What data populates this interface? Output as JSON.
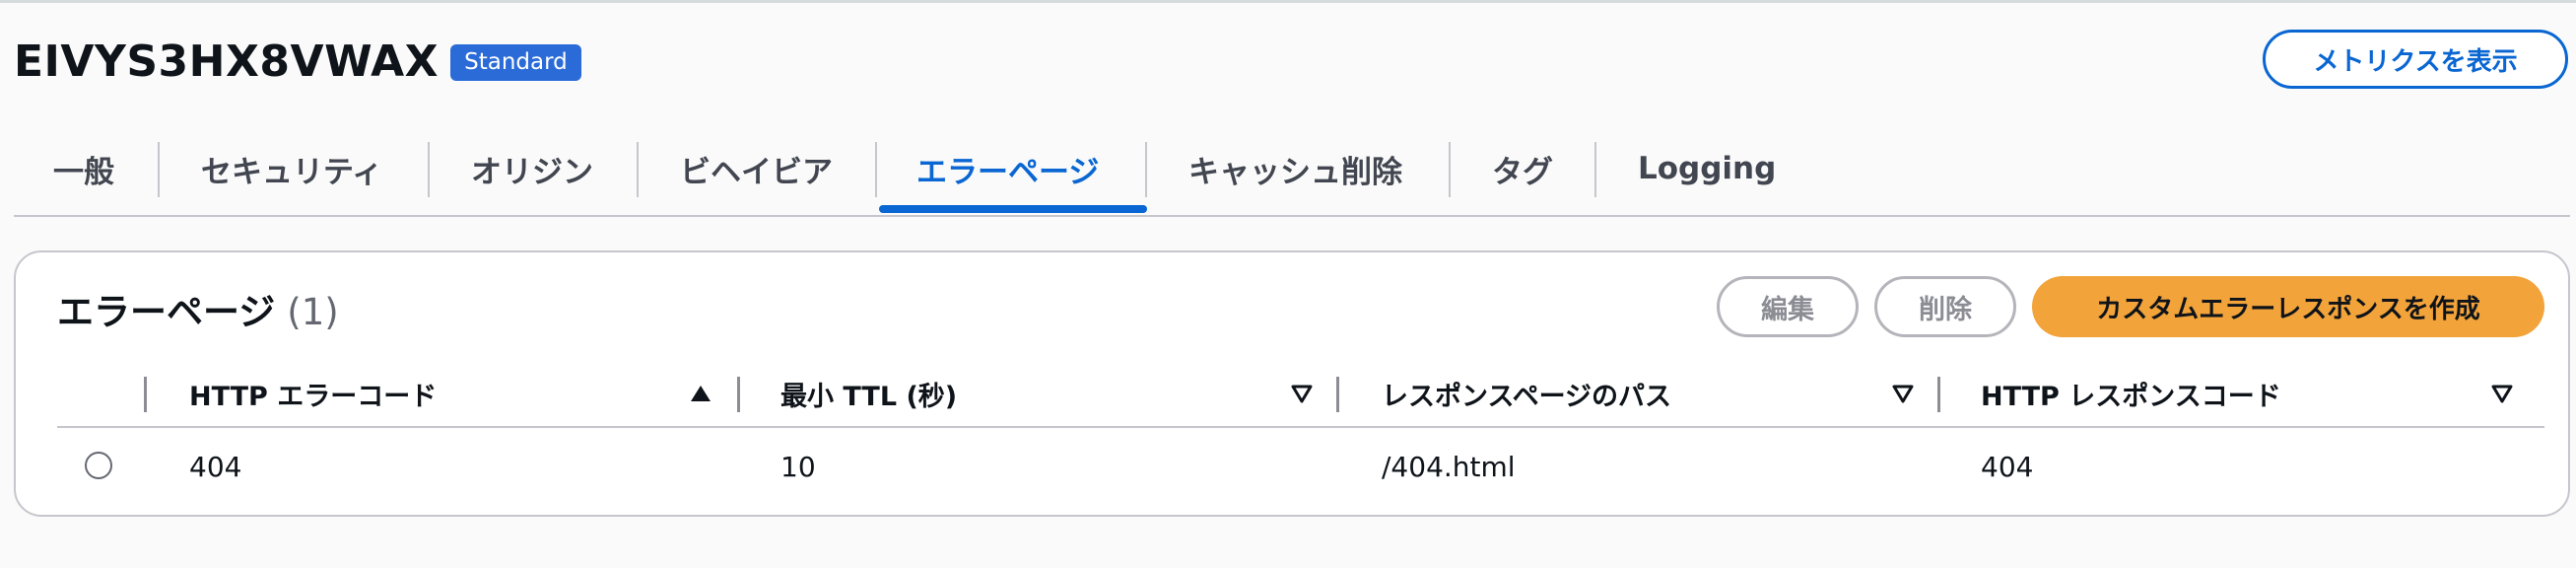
{
  "header": {
    "distribution_id": "EIVYS3HX8VWAX",
    "badge": "Standard",
    "metrics_button": "メトリクスを表示"
  },
  "tabs": [
    {
      "label": "一般"
    },
    {
      "label": "セキュリティ"
    },
    {
      "label": "オリジン"
    },
    {
      "label": "ビヘイビア"
    },
    {
      "label": "エラーページ",
      "active": true
    },
    {
      "label": "キャッシュ削除"
    },
    {
      "label": "タグ"
    },
    {
      "label": "Logging"
    }
  ],
  "error_pages": {
    "title": "エラーページ",
    "count": "(1)",
    "edit_button": "編集",
    "delete_button": "削除",
    "create_button": "カスタムエラーレスポンスを作成",
    "columns": [
      {
        "label": "HTTP エラーコード",
        "sort": "ascending"
      },
      {
        "label": "最小 TTL (秒)",
        "sort": "none"
      },
      {
        "label": "レスポンスページのパス",
        "sort": "none"
      },
      {
        "label": "HTTP レスポンスコード",
        "sort": "none"
      }
    ],
    "rows": [
      {
        "error_code": "404",
        "min_ttl": "10",
        "response_path": "/404.html",
        "response_code": "404",
        "selected": false
      }
    ]
  },
  "colors": {
    "accent_blue": "#0966d2",
    "badge_blue": "#2a6bd8",
    "primary_orange": "#f2a33a",
    "disabled_gray": "#8c8c94"
  }
}
